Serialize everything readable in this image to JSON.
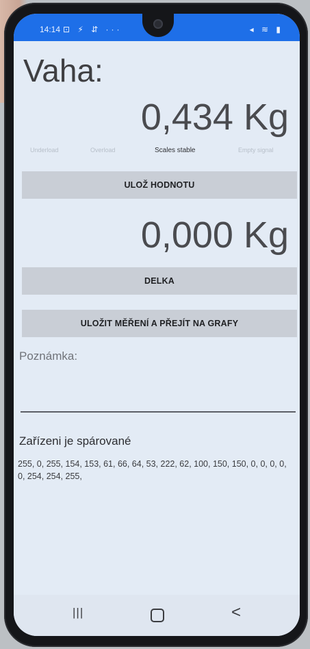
{
  "statusbar": {
    "time": "14:14",
    "left_icons": "⊡ ⚡ ⇵ ···",
    "right_icons": "◂ ≋ ▮"
  },
  "app": {
    "title": "Vaha:",
    "weight_main": "0,434 Kg",
    "indicators": {
      "underload": "Underload",
      "overload": "Overload",
      "scales_stable": "Scales stable",
      "empty_signal": "Empty signal"
    },
    "save_value_button": "ULOŽ HODNOTU",
    "weight_second": "0,000 Kg",
    "delka_button": "DELKA",
    "save_and_graphs_button": "ULOŽIT MĚŘENÍ A PŘEJÍT NA GRAFY",
    "note_label": "Poznámka:",
    "note_value": "",
    "paired_status": "Zařízeni je spárované",
    "bytes": "255, 0, 255, 154, 153, 61, 66, 64, 53, 222, 62, 100, 150, 150, 0, 0, 0, 0, 0, 254, 254, 255,"
  },
  "navbar": {
    "recent": "|||",
    "back": "<"
  },
  "colors": {
    "statusbar": "#1e6fe8",
    "screen_bg": "#e3ebf5",
    "button_bg": "#c9ced6"
  }
}
